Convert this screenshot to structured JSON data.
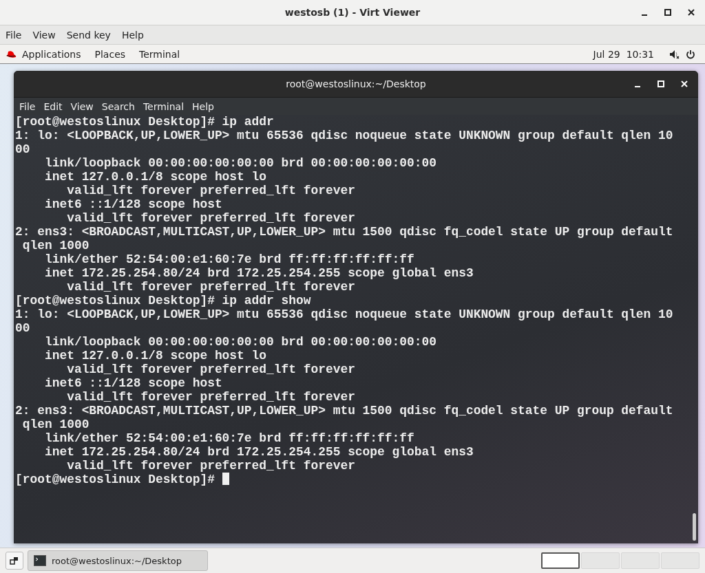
{
  "window": {
    "title": "westosb (1) - Virt Viewer"
  },
  "menu": [
    "File",
    "View",
    "Send key",
    "Help"
  ],
  "top_bar": {
    "items": [
      "Applications",
      "Places",
      "Terminal"
    ],
    "clock": "Jul 29  10:31"
  },
  "terminal": {
    "title": "root@westoslinux:~/Desktop",
    "menu": [
      "File",
      "Edit",
      "View",
      "Search",
      "Terminal",
      "Help"
    ],
    "lines": [
      "[root@westoslinux Desktop]# ip addr",
      "1: lo: <LOOPBACK,UP,LOWER_UP> mtu 65536 qdisc noqueue state UNKNOWN group default qlen 10",
      "00",
      "    link/loopback 00:00:00:00:00:00 brd 00:00:00:00:00:00",
      "    inet 127.0.0.1/8 scope host lo",
      "       valid_lft forever preferred_lft forever",
      "    inet6 ::1/128 scope host",
      "       valid_lft forever preferred_lft forever",
      "2: ens3: <BROADCAST,MULTICAST,UP,LOWER_UP> mtu 1500 qdisc fq_codel state UP group default",
      " qlen 1000",
      "    link/ether 52:54:00:e1:60:7e brd ff:ff:ff:ff:ff:ff",
      "    inet 172.25.254.80/24 brd 172.25.254.255 scope global ens3",
      "       valid_lft forever preferred_lft forever",
      "[root@westoslinux Desktop]# ip addr show",
      "1: lo: <LOOPBACK,UP,LOWER_UP> mtu 65536 qdisc noqueue state UNKNOWN group default qlen 10",
      "00",
      "    link/loopback 00:00:00:00:00:00 brd 00:00:00:00:00:00",
      "    inet 127.0.0.1/8 scope host lo",
      "       valid_lft forever preferred_lft forever",
      "    inet6 ::1/128 scope host",
      "       valid_lft forever preferred_lft forever",
      "2: ens3: <BROADCAST,MULTICAST,UP,LOWER_UP> mtu 1500 qdisc fq_codel state UP group default",
      " qlen 1000",
      "    link/ether 52:54:00:e1:60:7e brd ff:ff:ff:ff:ff:ff",
      "    inet 172.25.254.80/24 brd 172.25.254.255 scope global ens3",
      "       valid_lft forever preferred_lft forever"
    ],
    "prompt": "[root@westoslinux Desktop]# "
  },
  "taskbar": {
    "task": "root@westoslinux:~/Desktop",
    "workspaces": [
      {
        "selected": true
      },
      {
        "selected": false
      },
      {
        "selected": false
      },
      {
        "selected": false
      }
    ]
  }
}
